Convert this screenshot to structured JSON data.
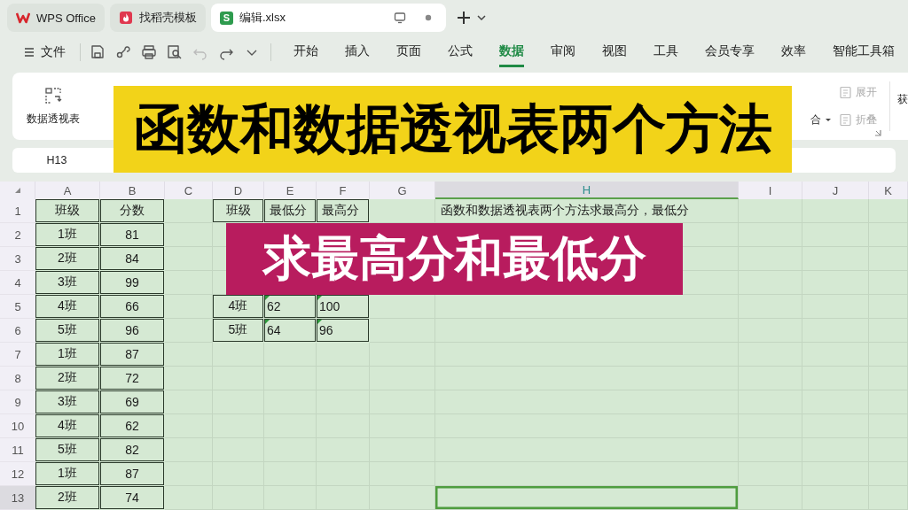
{
  "tabs": [
    {
      "label": "WPS Office",
      "kind": "home",
      "selected": false
    },
    {
      "label": "找稻壳模板",
      "kind": "template",
      "selected": false
    },
    {
      "label": "编辑.xlsx",
      "kind": "sheet",
      "logo_text": "S",
      "selected": true
    }
  ],
  "menu": {
    "file": "文件",
    "items": [
      {
        "label": "开始",
        "selected": false
      },
      {
        "label": "插入",
        "selected": false
      },
      {
        "label": "页面",
        "selected": false
      },
      {
        "label": "公式",
        "selected": false
      },
      {
        "label": "数据",
        "selected": true
      },
      {
        "label": "审阅",
        "selected": false
      },
      {
        "label": "视图",
        "selected": false
      },
      {
        "label": "工具",
        "selected": false
      },
      {
        "label": "会员专享",
        "selected": false
      },
      {
        "label": "效率",
        "selected": false
      },
      {
        "label": "智能工具箱",
        "selected": false
      }
    ]
  },
  "ribbon": {
    "pivot": "数据透视表",
    "ungroup": "合",
    "outline": [
      {
        "label": "展开",
        "disabled": true
      },
      {
        "label": "折叠",
        "disabled": true
      }
    ],
    "fetch": "获"
  },
  "name_box": "H13",
  "sheet": {
    "columns": [
      {
        "label": "A",
        "selected": false
      },
      {
        "label": "B",
        "selected": false
      },
      {
        "label": "C",
        "selected": false
      },
      {
        "label": "D",
        "selected": false
      },
      {
        "label": "E",
        "selected": false
      },
      {
        "label": "F",
        "selected": false
      },
      {
        "label": "G",
        "selected": false
      },
      {
        "label": "H",
        "selected": true
      },
      {
        "label": "I",
        "selected": false
      },
      {
        "label": "J",
        "selected": false
      },
      {
        "label": "K",
        "selected": false
      }
    ],
    "rows": [
      {
        "number": "1",
        "selected": false,
        "cells": [
          {
            "text": "班级",
            "kind": "center",
            "bordered": true
          },
          {
            "text": "分数",
            "kind": "center",
            "bordered": true
          },
          {
            "text": "",
            "kind": "center",
            "bordered": false
          },
          {
            "text": "班级",
            "kind": "center",
            "bordered": true
          },
          {
            "text": "最低分",
            "kind": "left",
            "bordered": true
          },
          {
            "text": "最高分",
            "kind": "left",
            "bordered": true
          },
          {
            "text": "",
            "kind": "center",
            "bordered": false
          },
          {
            "text": "函数和数据透视表两个方法求最高分，最低分",
            "kind": "left",
            "bordered": false
          }
        ]
      },
      {
        "number": "2",
        "selected": false,
        "cells": [
          {
            "text": "1班",
            "kind": "center",
            "bordered": true
          },
          {
            "text": "81",
            "kind": "center",
            "bordered": true
          }
        ]
      },
      {
        "number": "3",
        "selected": false,
        "cells": [
          {
            "text": "2班",
            "kind": "center",
            "bordered": true
          },
          {
            "text": "84",
            "kind": "center",
            "bordered": true
          }
        ]
      },
      {
        "number": "4",
        "selected": false,
        "cells": [
          {
            "text": "3班",
            "kind": "center",
            "bordered": true
          },
          {
            "text": "99",
            "kind": "center",
            "bordered": true
          }
        ]
      },
      {
        "number": "5",
        "selected": false,
        "cells": [
          {
            "text": "4班",
            "kind": "center",
            "bordered": true
          },
          {
            "text": "66",
            "kind": "center",
            "bordered": true
          },
          {
            "text": "",
            "kind": "center",
            "bordered": false
          },
          {
            "text": "4班",
            "kind": "center",
            "bordered": true
          },
          {
            "text": "62",
            "kind": "number_text",
            "bordered": true
          },
          {
            "text": "100",
            "kind": "number_text",
            "bordered": true
          }
        ]
      },
      {
        "number": "6",
        "selected": false,
        "cells": [
          {
            "text": "5班",
            "kind": "center",
            "bordered": true
          },
          {
            "text": "96",
            "kind": "center",
            "bordered": true
          },
          {
            "text": "",
            "kind": "center",
            "bordered": false
          },
          {
            "text": "5班",
            "kind": "center",
            "bordered": true
          },
          {
            "text": "64",
            "kind": "number_text",
            "bordered": true
          },
          {
            "text": "96",
            "kind": "number_text",
            "bordered": true
          }
        ]
      },
      {
        "number": "7",
        "selected": false,
        "cells": [
          {
            "text": "1班",
            "kind": "center",
            "bordered": true
          },
          {
            "text": "87",
            "kind": "center",
            "bordered": true
          }
        ]
      },
      {
        "number": "8",
        "selected": false,
        "cells": [
          {
            "text": "2班",
            "kind": "center",
            "bordered": true
          },
          {
            "text": "72",
            "kind": "center",
            "bordered": true
          }
        ]
      },
      {
        "number": "9",
        "selected": false,
        "cells": [
          {
            "text": "3班",
            "kind": "center",
            "bordered": true
          },
          {
            "text": "69",
            "kind": "center",
            "bordered": true
          }
        ]
      },
      {
        "number": "10",
        "selected": false,
        "cells": [
          {
            "text": "4班",
            "kind": "center",
            "bordered": true
          },
          {
            "text": "62",
            "kind": "center",
            "bordered": true
          }
        ]
      },
      {
        "number": "11",
        "selected": false,
        "cells": [
          {
            "text": "5班",
            "kind": "center",
            "bordered": true
          },
          {
            "text": "82",
            "kind": "center",
            "bordered": true
          }
        ]
      },
      {
        "number": "12",
        "selected": false,
        "cells": [
          {
            "text": "1班",
            "kind": "center",
            "bordered": true
          },
          {
            "text": "87",
            "kind": "center",
            "bordered": true
          }
        ]
      },
      {
        "number": "13",
        "selected": true,
        "cells": [
          {
            "text": "2班",
            "kind": "center",
            "bordered": true
          },
          {
            "text": "74",
            "kind": "center",
            "bordered": true
          }
        ]
      }
    ]
  },
  "captions": [
    {
      "text": "函数和数据透视表两个方法",
      "kind": "title",
      "color": "#f2d319"
    },
    {
      "text": "求最高分和最低分",
      "kind": "subtitle",
      "color": "#b81c5e"
    }
  ]
}
